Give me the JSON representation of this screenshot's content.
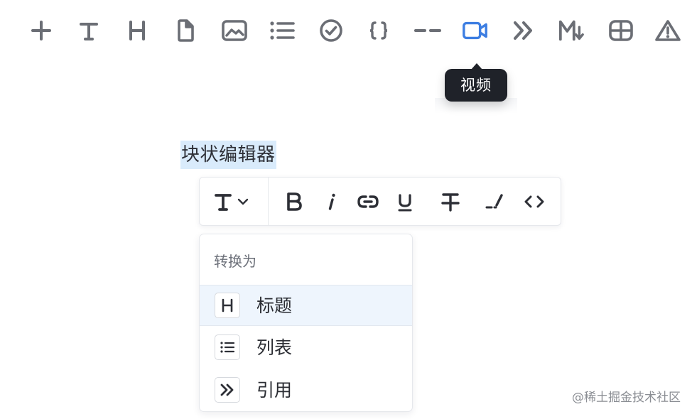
{
  "block_toolbar": {
    "items": [
      {
        "icon": "plus-icon",
        "label": ""
      },
      {
        "icon": "text-icon",
        "label": ""
      },
      {
        "icon": "heading-icon",
        "label": ""
      },
      {
        "icon": "file-icon",
        "label": ""
      },
      {
        "icon": "image-icon",
        "label": ""
      },
      {
        "icon": "list-icon",
        "label": ""
      },
      {
        "icon": "check-circle-icon",
        "label": ""
      },
      {
        "icon": "code-braces-icon",
        "label": ""
      },
      {
        "icon": "divider-icon",
        "label": ""
      },
      {
        "icon": "video-icon",
        "label": "",
        "active": true
      },
      {
        "icon": "quote-icon",
        "label": ""
      },
      {
        "icon": "markdown-icon",
        "label": ""
      },
      {
        "icon": "table-icon",
        "label": ""
      },
      {
        "icon": "warning-icon",
        "label": ""
      }
    ],
    "icon_color": "#6b6e75",
    "active_color": "#3d7ee2"
  },
  "tooltip": {
    "text": "视频"
  },
  "editor": {
    "selected_text": "块状编辑器",
    "selection_color": "#d9ebfb"
  },
  "format_toolbar": {
    "type_icon": "text-type-icon",
    "buttons": [
      {
        "icon": "bold-icon"
      },
      {
        "icon": "italic-icon"
      },
      {
        "icon": "link-icon"
      },
      {
        "icon": "underline-icon"
      },
      {
        "icon": "strikethrough-icon"
      },
      {
        "icon": "highlight-pen-icon"
      },
      {
        "icon": "inline-code-icon"
      }
    ]
  },
  "convert_menu": {
    "header": "转换为",
    "items": [
      {
        "icon": "heading-icon",
        "label": "标题",
        "active": true
      },
      {
        "icon": "list-icon",
        "label": "列表",
        "active": false
      },
      {
        "icon": "quote-icon",
        "label": "引用",
        "active": false
      }
    ]
  },
  "watermark": "@稀土掘金技术社区"
}
